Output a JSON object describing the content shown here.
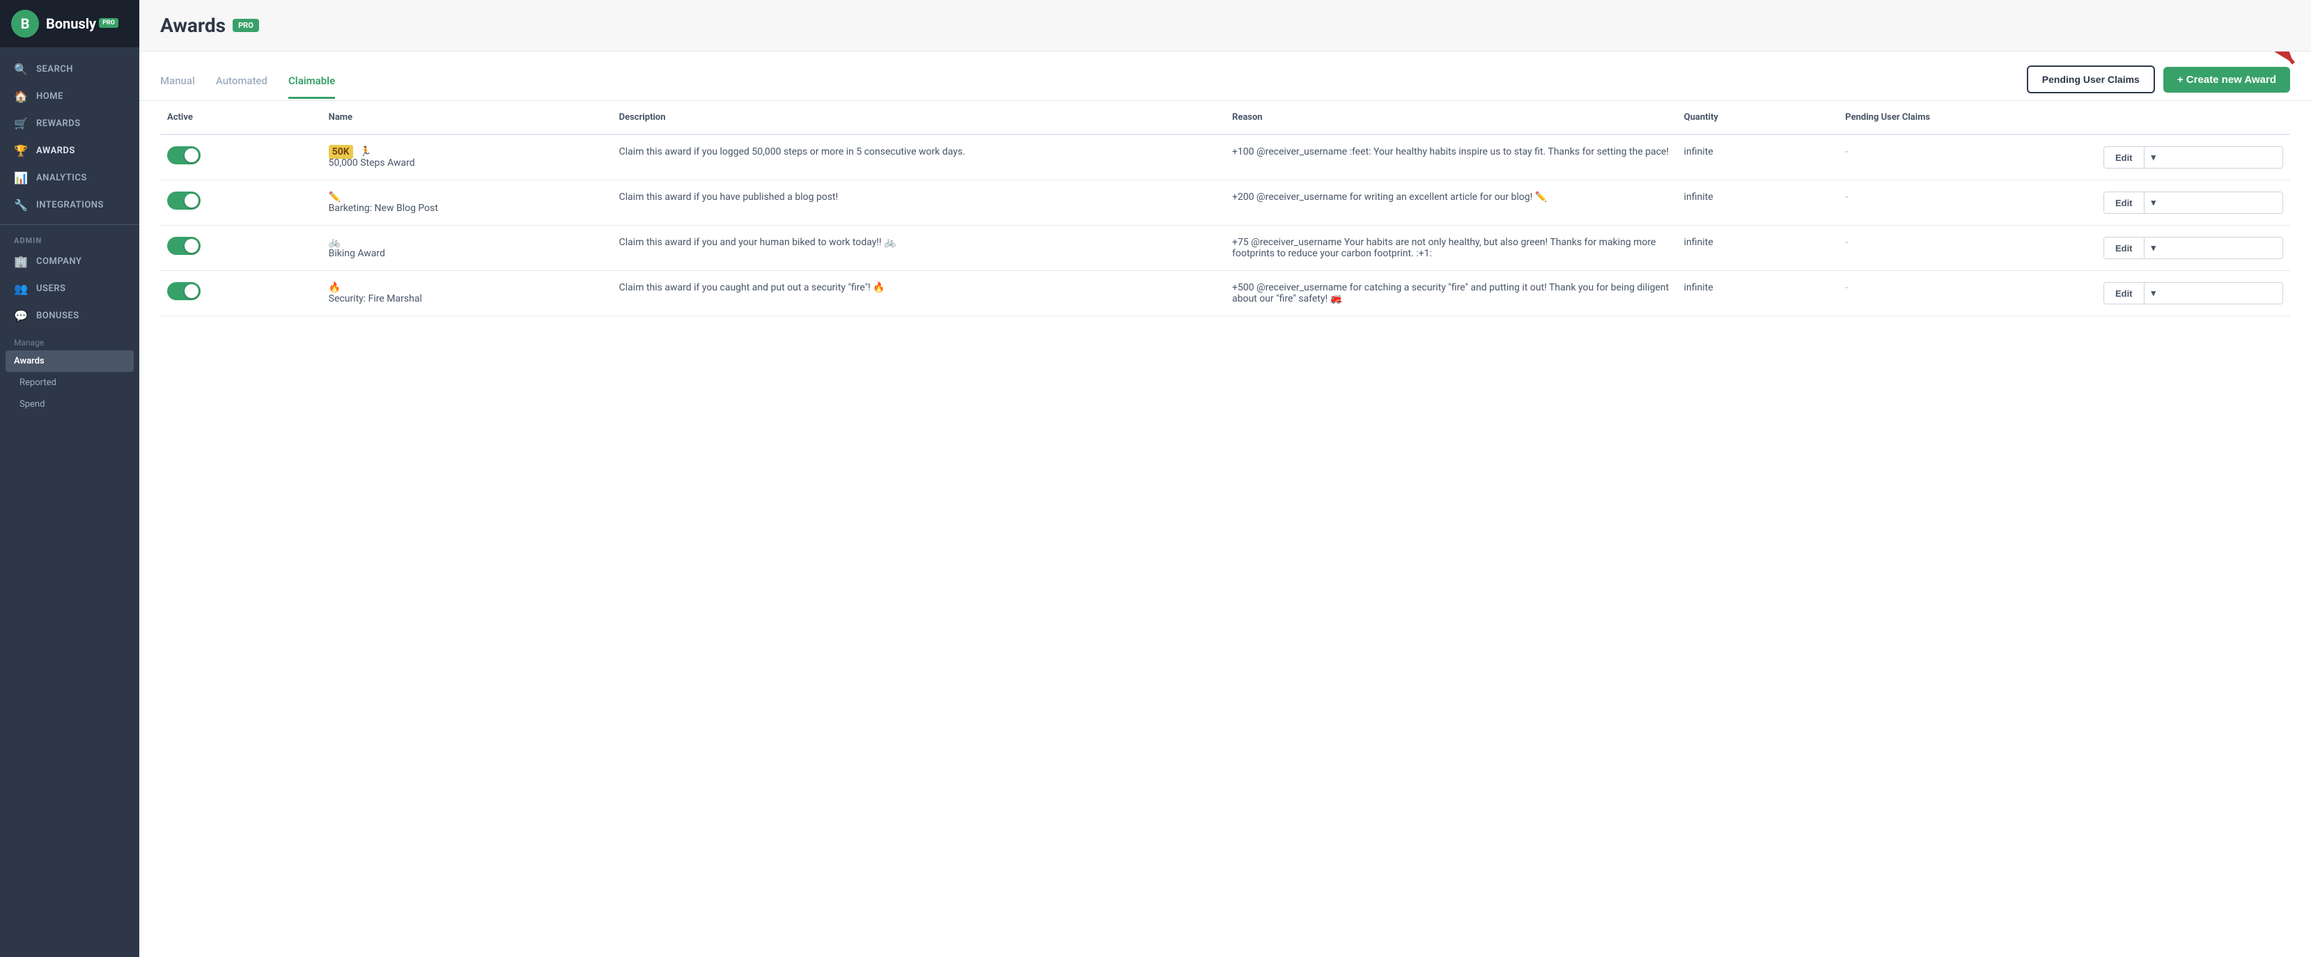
{
  "sidebar": {
    "logo_letter": "B",
    "logo_text": "Bonusly",
    "pro_badge": "PRO",
    "nav_items": [
      {
        "id": "search",
        "label": "Search",
        "icon": "🔍"
      },
      {
        "id": "home",
        "label": "Home",
        "icon": "🏠"
      },
      {
        "id": "rewards",
        "label": "Rewards",
        "icon": "🛒"
      },
      {
        "id": "awards",
        "label": "Awards",
        "icon": "🏆"
      },
      {
        "id": "analytics",
        "label": "Analytics",
        "icon": "📊"
      },
      {
        "id": "integrations",
        "label": "Integrations",
        "icon": "🔧"
      }
    ],
    "admin_label": "ADMIN",
    "admin_items": [
      {
        "id": "company",
        "label": "Company",
        "icon": "🏢"
      },
      {
        "id": "users",
        "label": "Users",
        "icon": "👥"
      },
      {
        "id": "bonuses",
        "label": "Bonuses",
        "icon": "💬"
      }
    ],
    "manage_label": "Manage",
    "sub_items": [
      {
        "id": "awards-sub",
        "label": "Awards",
        "active": true
      },
      {
        "id": "reported",
        "label": "Reported",
        "active": false
      },
      {
        "id": "spend",
        "label": "Spend",
        "active": false
      }
    ]
  },
  "page": {
    "title": "Awards",
    "pro_badge": "PRO"
  },
  "tabs": [
    {
      "id": "manual",
      "label": "Manual",
      "active": false
    },
    {
      "id": "automated",
      "label": "Automated",
      "active": false
    },
    {
      "id": "claimable",
      "label": "Claimable",
      "active": true
    }
  ],
  "buttons": {
    "pending_claims": "Pending User Claims",
    "create_award": "+ Create new Award"
  },
  "table": {
    "headers": [
      "Active",
      "Name",
      "Description",
      "Reason",
      "Quantity",
      "Pending User Claims"
    ],
    "rows": [
      {
        "active": true,
        "icon": "50K 🏃",
        "name": "50,000 Steps Award",
        "description": "Claim this award if you logged 50,000 steps or more in 5 consecutive work days.",
        "reason": "+100 @receiver_username :feet: Your healthy habits inspire us to stay fit. Thanks for setting the pace!",
        "quantity": "infinite",
        "pending": "-"
      },
      {
        "active": true,
        "icon": "✏️",
        "name": "Barketing: New Blog Post",
        "description": "Claim this award if you have published a blog post!",
        "reason": "+200 @receiver_username for writing an excellent article for our blog! ✏️",
        "quantity": "infinite",
        "pending": "-"
      },
      {
        "active": true,
        "icon": "🚲",
        "name": "Biking Award",
        "description": "Claim this award if you and your human biked to work today!! 🚲",
        "reason": "+75 @receiver_username Your habits are not only healthy, but also green! Thanks for making more footprints to reduce your carbon footprint. :+1:",
        "quantity": "infinite",
        "pending": "-"
      },
      {
        "active": true,
        "icon": "🔥",
        "name": "Security: Fire Marshal",
        "description": "Claim this award if you caught and put out a security \"fire\"! 🔥",
        "reason": "+500 @receiver_username for catching a security \"fire\" and putting it out! Thank you for being diligent about our \"fire\" safety! 🚒",
        "quantity": "infinite",
        "pending": "-"
      }
    ]
  }
}
